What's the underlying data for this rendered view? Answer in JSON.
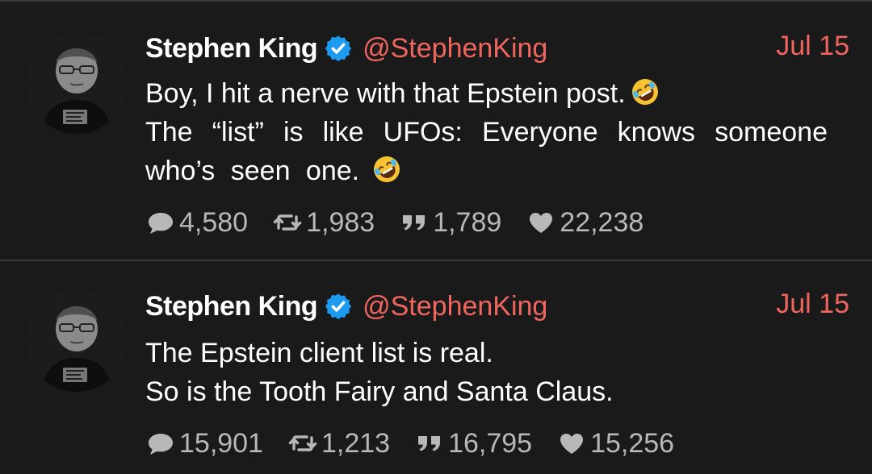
{
  "colors": {
    "background": "#1a1a1a",
    "handle": "#f0665e",
    "date": "#f0665e",
    "verified": "#1d9bf0",
    "stats": "#b8b8b8"
  },
  "tweets": [
    {
      "author": "Stephen King",
      "handle": "@StephenKing",
      "verified": true,
      "date": "Jul 15",
      "lines": [
        "Boy, I hit a nerve with that Epstein post.",
        "The “list” is like UFOs: Everyone knows someone",
        "who’s seen one."
      ],
      "emoji": "rolling-on-floor-laughing",
      "stats": {
        "replies": "4,580",
        "retweets": "1,983",
        "quotes": "1,789",
        "likes": "22,238"
      }
    },
    {
      "author": "Stephen King",
      "handle": "@StephenKing",
      "verified": true,
      "date": "Jul 15",
      "lines": [
        "The Epstein client list is real.",
        "So is the Tooth Fairy and Santa Claus."
      ],
      "stats": {
        "replies": "15,901",
        "retweets": "1,213",
        "quotes": "16,795",
        "likes": "15,256"
      }
    }
  ]
}
